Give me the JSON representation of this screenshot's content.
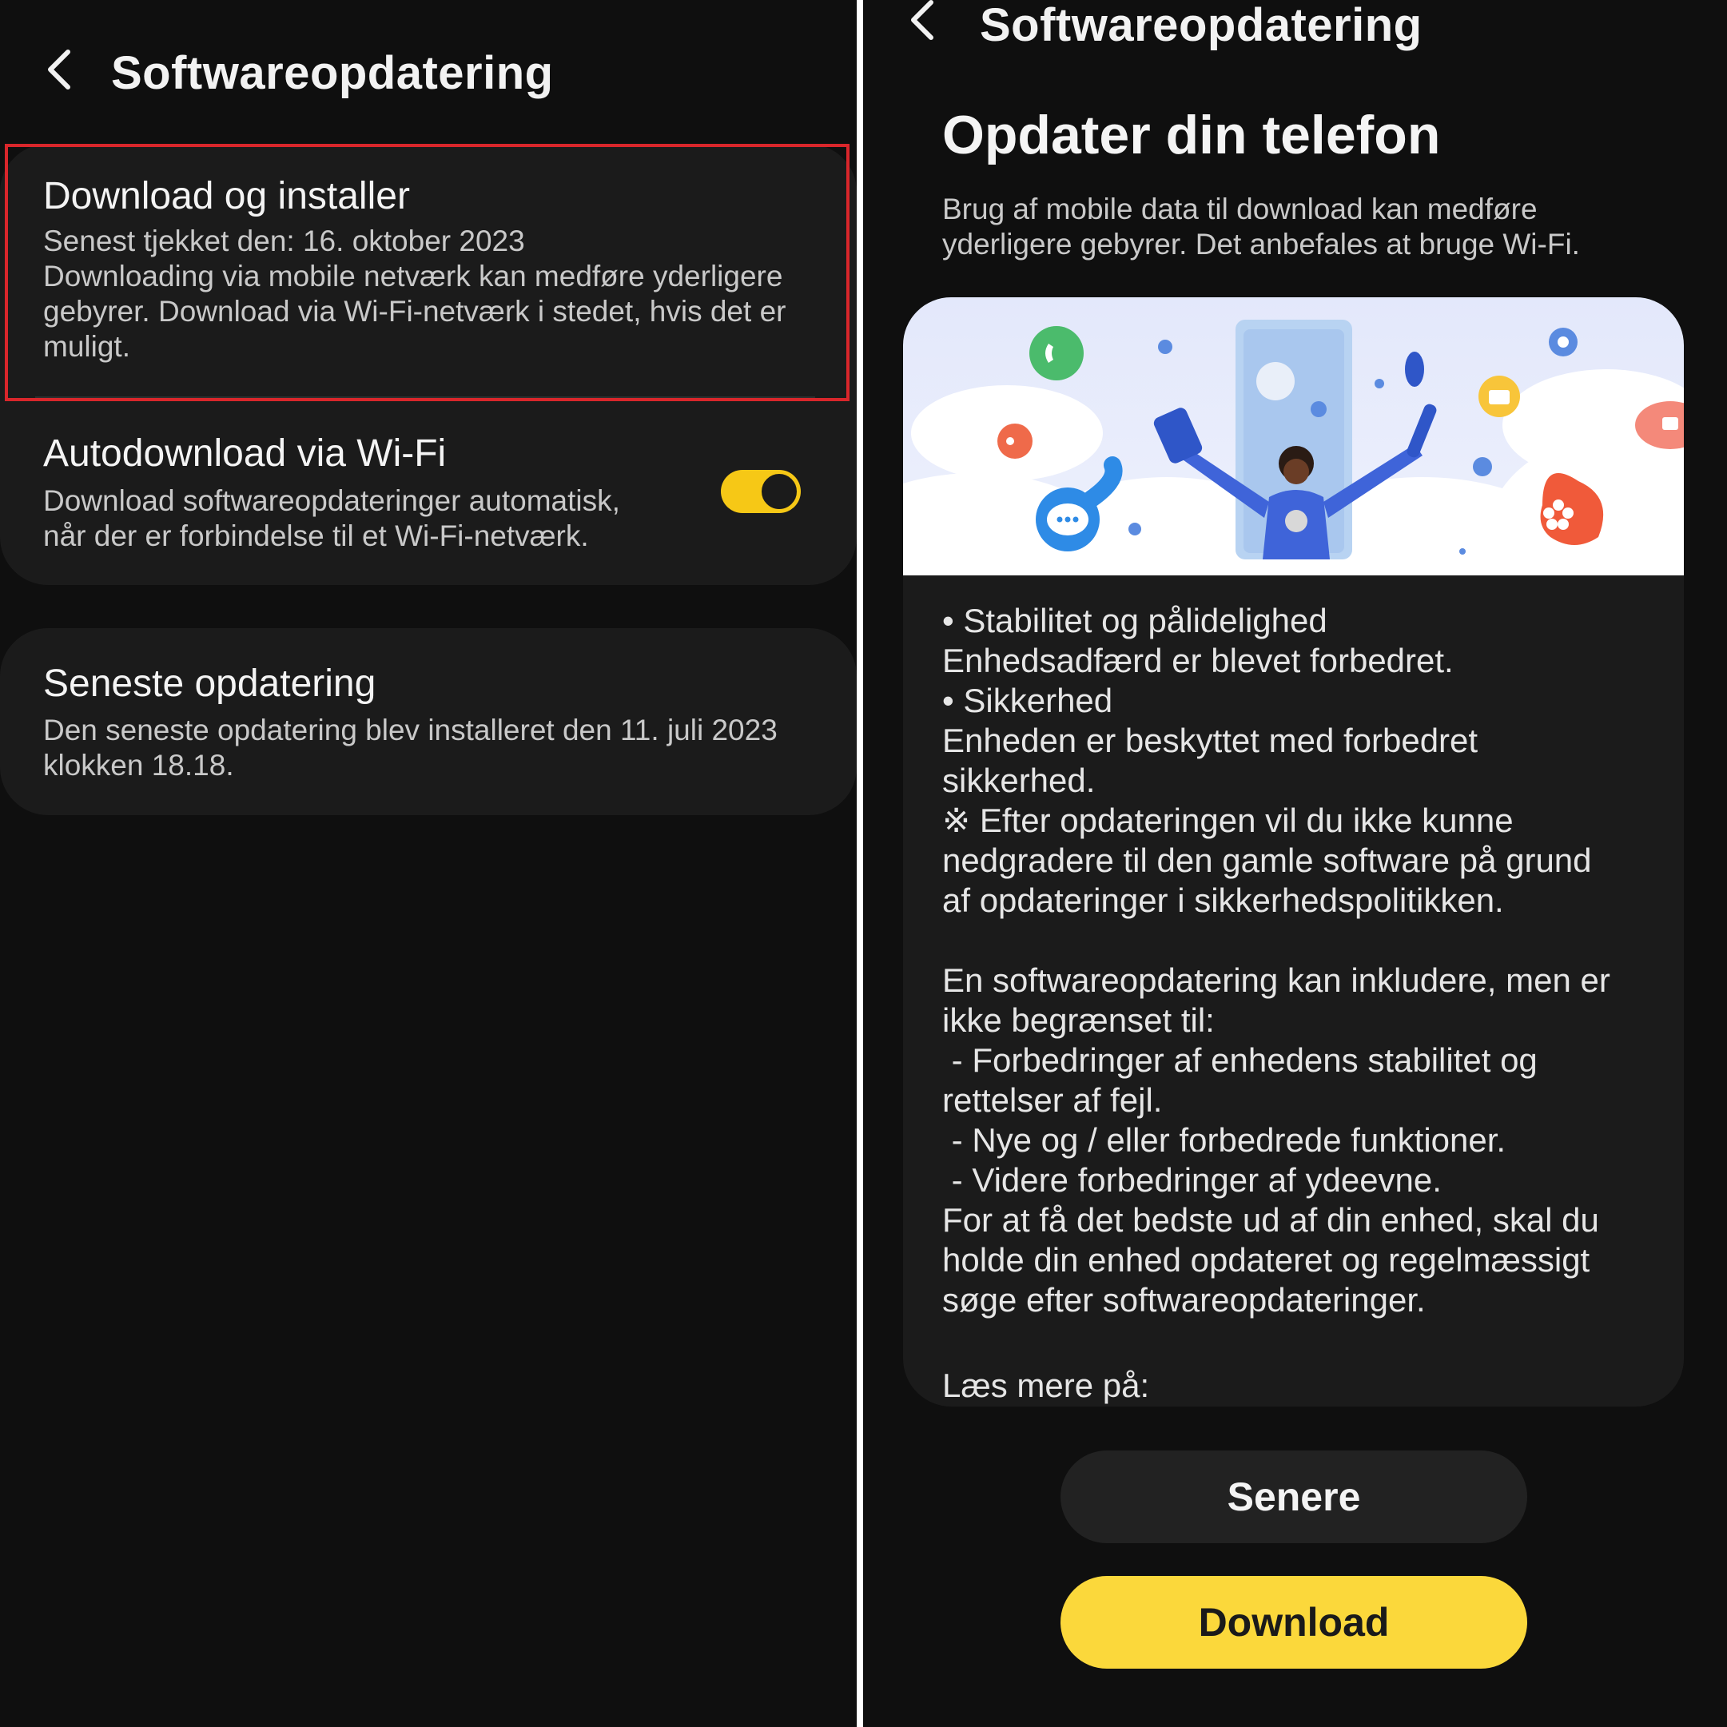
{
  "left_screen": {
    "header": {
      "title": "Softwareopdatering",
      "back_icon": "chevron-left-icon"
    },
    "download_install": {
      "title": "Download og installer",
      "last_checked": "Senest tjekket den: 16. oktober 2023",
      "line1": "Downloading via mobile netværk kan medføre yderligere",
      "line2": "gebyrer. Download via Wi-Fi-netværk i stedet, hvis det er",
      "line3": "muligt."
    },
    "autodownload": {
      "title": "Autodownload via Wi-Fi",
      "line1": "Download softwareopdateringer automatisk,",
      "line2": "når der er forbindelse til et Wi-Fi-netværk.",
      "toggle_on": true
    },
    "last_update": {
      "title": "Seneste opdatering",
      "line1": "Den seneste opdatering blev installeret den 11. juli 2023",
      "line2": "klokken 18.18."
    },
    "colors": {
      "background": "#0f0f0f",
      "card": "#1b1b1b",
      "highlight": "#d9262b",
      "toggle": "#f6c816"
    }
  },
  "right_screen": {
    "header": {
      "title": "Softwareopdatering",
      "back_icon": "chevron-left-icon"
    },
    "headline": "Opdater din telefon",
    "intro": {
      "line1": "Brug af mobile data til download kan medføre",
      "line2": "yderligere gebyrer. Det anbefales at bruge Wi-Fi."
    },
    "notes": [
      "• Stabilitet og pålidelighed",
      "Enhedsadfærd er blevet forbedret.",
      "• Sikkerhed",
      "Enheden er beskyttet med forbedret",
      "sikkerhed.",
      "※ Efter opdateringen vil du ikke kunne",
      "nedgradere til den gamle software på grund",
      "af opdateringer i sikkerhedspolitikken.",
      "",
      "En softwareopdatering kan inkludere, men er",
      "ikke begrænset til:",
      " - Forbedringer af enhedens stabilitet og",
      "rettelser af fejl.",
      " - Nye og / eller forbedrede funktioner.",
      " - Videre forbedringer af ydeevne.",
      "For at få det bedste ud af din enhed, skal du",
      "holde din enhed opdateret og regelmæssigt",
      "søge efter softwareopdateringer."
    ],
    "read_more": "Læs mere på:",
    "buttons": {
      "later": "Senere",
      "download": "Download"
    },
    "colors": {
      "download_button": "#fbd83b",
      "later_button": "#222222"
    }
  }
}
